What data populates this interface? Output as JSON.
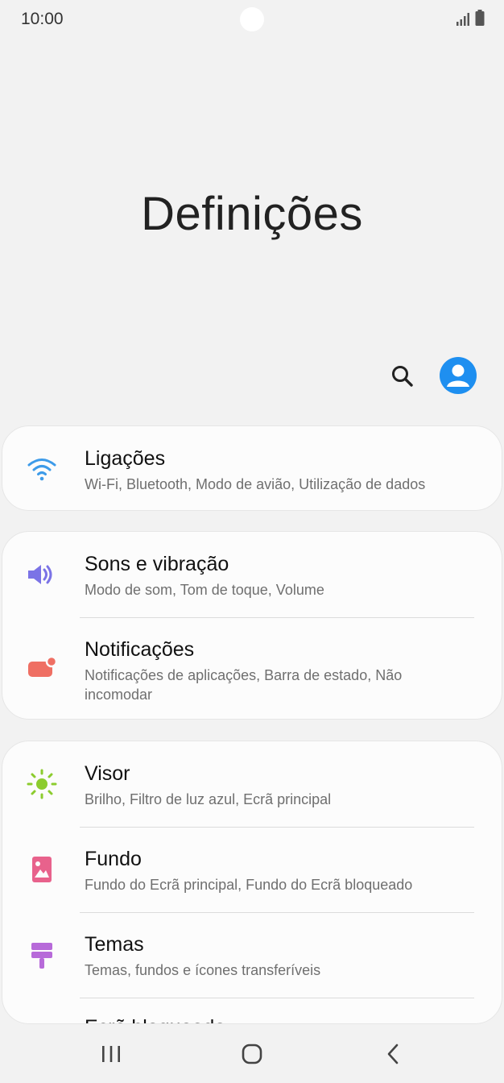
{
  "status": {
    "time": "10:00"
  },
  "page": {
    "title": "Definições"
  },
  "header": {
    "search_icon": "search-icon",
    "profile_icon": "profile-icon"
  },
  "groups": [
    {
      "items": [
        {
          "label": "Ligações",
          "sub": "Wi-Fi, Bluetooth, Modo de avião, Utilização de dados",
          "icon": "wifi-icon",
          "color": "#3d9be9"
        }
      ]
    },
    {
      "items": [
        {
          "label": "Sons e vibração",
          "sub": "Modo de som, Tom de toque, Volume",
          "icon": "speaker-icon",
          "color": "#7b73e6"
        },
        {
          "label": "Notificações",
          "sub": "Notificações de aplicações, Barra de estado, Não incomodar",
          "icon": "notification-icon",
          "color": "#ef6f63"
        }
      ]
    },
    {
      "items": [
        {
          "label": "Visor",
          "sub": "Brilho, Filtro de luz azul, Ecrã principal",
          "icon": "brightness-icon",
          "color": "#8ccc2e"
        },
        {
          "label": "Fundo",
          "sub": "Fundo do Ecrã principal, Fundo do Ecrã bloqueado",
          "icon": "wallpaper-icon",
          "color": "#e8628c"
        },
        {
          "label": "Temas",
          "sub": "Temas, fundos e ícones transferíveis",
          "icon": "themes-icon",
          "color": "#b76ad9"
        },
        {
          "label": "Ecrã bloqueado",
          "sub": "",
          "icon": "lock-screen-icon",
          "color": "#3f8fe8"
        }
      ]
    }
  ],
  "nav": {
    "recents": "recents-icon",
    "home": "home-icon",
    "back": "back-icon"
  }
}
